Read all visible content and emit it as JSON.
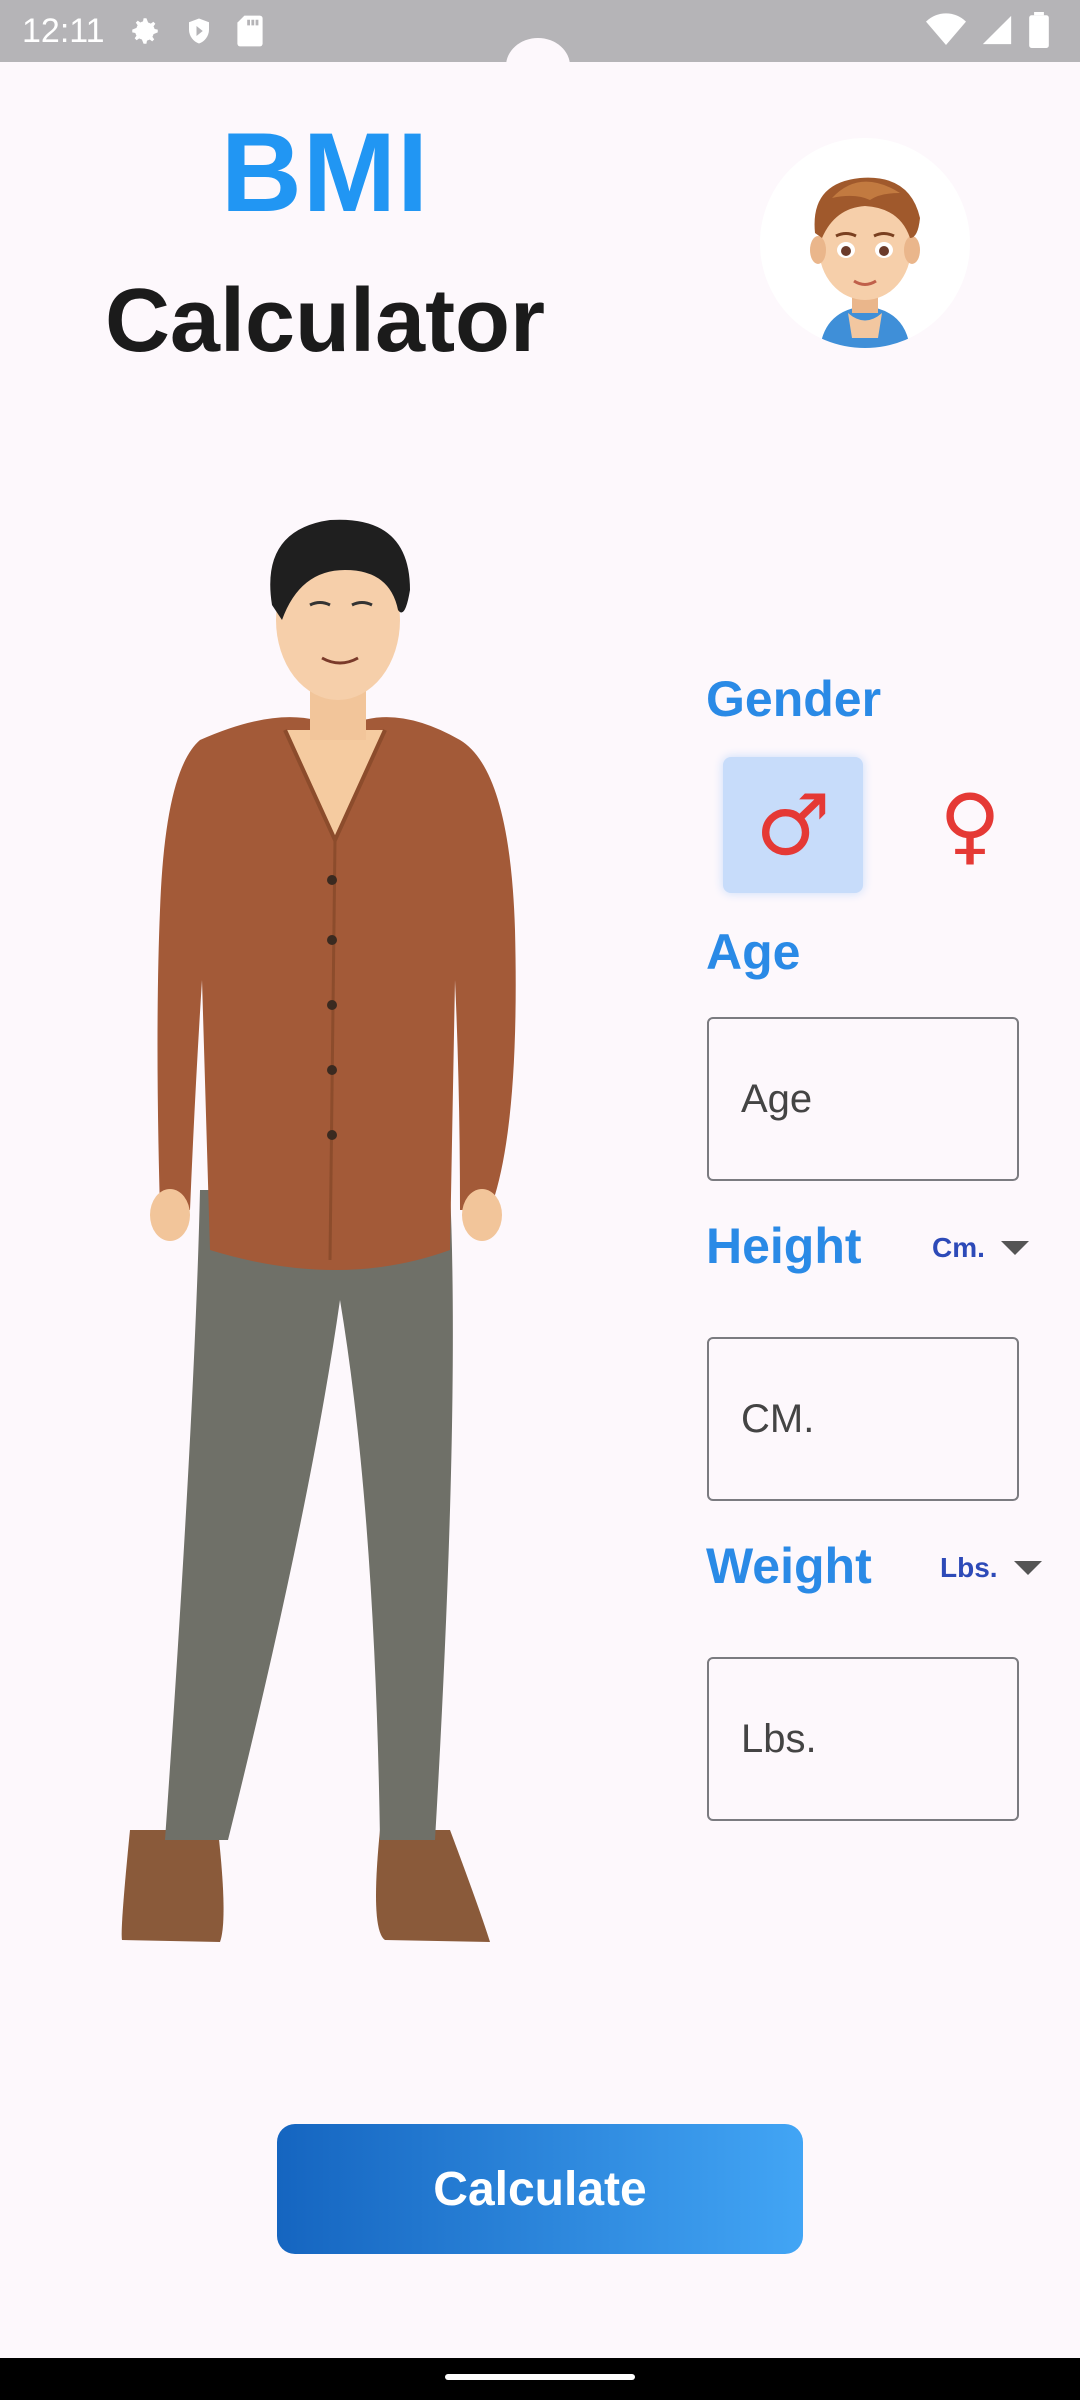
{
  "status_bar": {
    "time": "12:11",
    "left_icons": [
      "gear-icon",
      "shield-icon",
      "sd-card-icon"
    ],
    "right_icons": [
      "wifi-icon",
      "signal-icon",
      "battery-icon"
    ]
  },
  "header": {
    "title_line1": "BMI",
    "title_line2": "Calculator"
  },
  "form": {
    "gender_label": "Gender",
    "gender_selected": "male",
    "male_symbol": "♂",
    "female_symbol": "♀",
    "age_label": "Age",
    "age_placeholder": "Age",
    "height_label": "Height",
    "height_unit": "Cm.",
    "height_placeholder": "CM.",
    "weight_label": "Weight",
    "weight_unit": "Lbs.",
    "weight_placeholder": "Lbs."
  },
  "actions": {
    "calculate_label": "Calculate"
  },
  "colors": {
    "accent": "#2196f3",
    "gender_symbol": "#e53935",
    "selected_bg": "#c7dcfa",
    "button_start": "#1565c0",
    "button_end": "#42a5f5"
  }
}
